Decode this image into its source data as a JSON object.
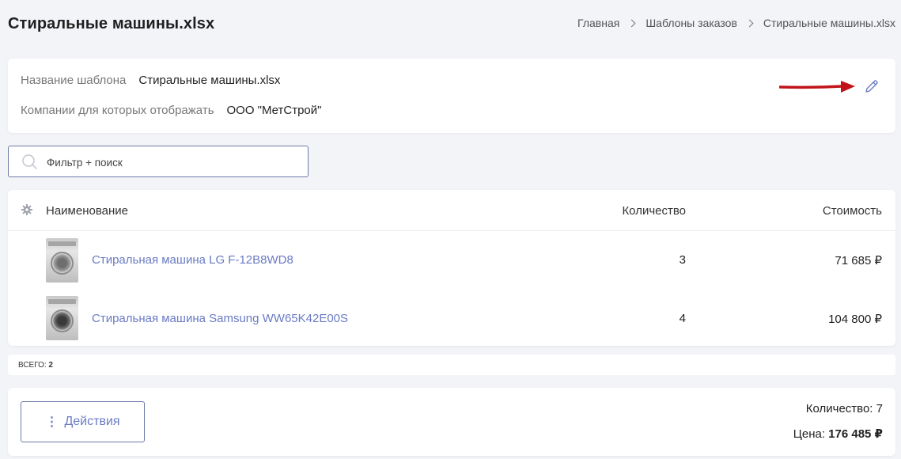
{
  "page": {
    "title": "Стиральные машины.xlsx"
  },
  "breadcrumb": {
    "items": [
      "Главная",
      "Шаблоны заказов",
      "Стиральные машины.xlsx"
    ]
  },
  "template_info": {
    "name_label": "Название шаблона",
    "name_value": "Стиральные машины.xlsx",
    "companies_label": "Компании для которых отображать",
    "companies_value": "ООО \"МетСтрой\"",
    "edit_icon": "pencil-icon",
    "annotation_color": "#c0141a"
  },
  "search": {
    "placeholder": "Фильтр + поиск",
    "value": ""
  },
  "table": {
    "columns": {
      "settings_icon": "gear-icon",
      "name": "Наименование",
      "quantity": "Количество",
      "cost": "Стоимость"
    },
    "rows": [
      {
        "name": "Стиральная машина LG F-12B8WD8",
        "quantity": "3",
        "cost": "71 685 ₽"
      },
      {
        "name": "Стиральная машина Samsung WW65K42E00S",
        "quantity": "4",
        "cost": "104 800 ₽"
      }
    ]
  },
  "totals_bar": {
    "label": "ВСЕГО:",
    "count": "2"
  },
  "footer": {
    "actions_dots": "⋮",
    "actions_label": "Действия",
    "quantity_label": "Количество:",
    "quantity_value": "7",
    "price_label": "Цена:",
    "price_value": "176 485 ₽"
  },
  "colors": {
    "accent": "#6a7bc4",
    "border_accent": "#6c7aa8",
    "background": "#f3f4f8"
  }
}
